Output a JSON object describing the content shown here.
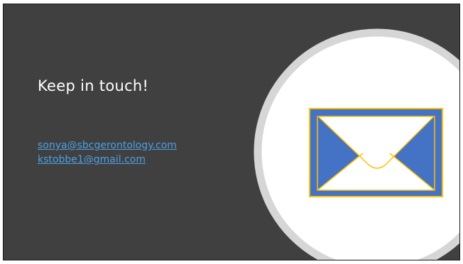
{
  "slide": {
    "title": "Keep in touch!",
    "emails": [
      "sonya@sbcgerontology.com",
      "kstobbe1@gmail.com"
    ]
  },
  "icons": {
    "main": "mail-envelope-icon"
  },
  "colors": {
    "background": "#404040",
    "title_text": "#ffffff",
    "link": "#4d9fe6",
    "circle_fill": "#ffffff",
    "circle_ring": "#d6d6d6",
    "envelope_blue": "#4472c4",
    "envelope_outline": "#ffc000"
  }
}
